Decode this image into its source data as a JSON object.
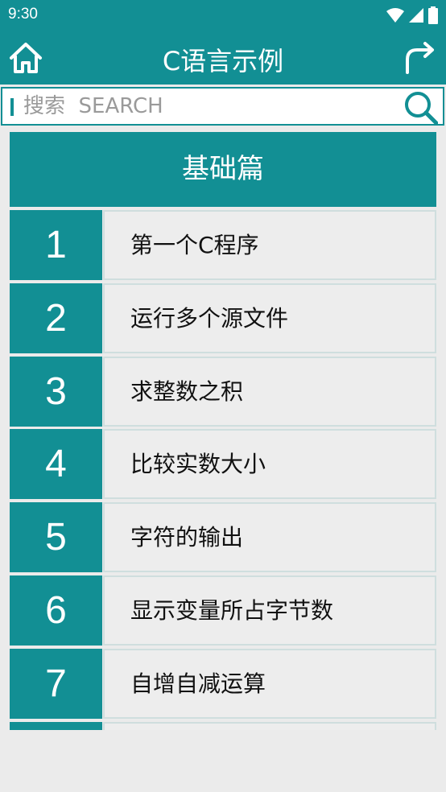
{
  "status_bar": {
    "time": "9:30"
  },
  "app_bar": {
    "title": "C语言示例"
  },
  "search": {
    "placeholder": "搜索  SEARCH"
  },
  "section": {
    "title": "基础篇"
  },
  "items": [
    {
      "number": "1",
      "label": "第一个C程序"
    },
    {
      "number": "2",
      "label": "运行多个源文件"
    },
    {
      "number": "3",
      "label": "求整数之积"
    },
    {
      "number": "4",
      "label": "比较实数大小"
    },
    {
      "number": "5",
      "label": "字符的输出"
    },
    {
      "number": "6",
      "label": "显示变量所占字节数"
    },
    {
      "number": "7",
      "label": "自增自减运算"
    },
    {
      "number": "",
      "label": ""
    }
  ],
  "icons": {
    "home": "home-icon",
    "redo": "redo-icon",
    "search": "search-icon",
    "wifi": "wifi-icon",
    "signal": "signal-icon",
    "battery": "battery-icon"
  },
  "colors": {
    "primary": "#128f94",
    "background": "#ebebeb"
  }
}
